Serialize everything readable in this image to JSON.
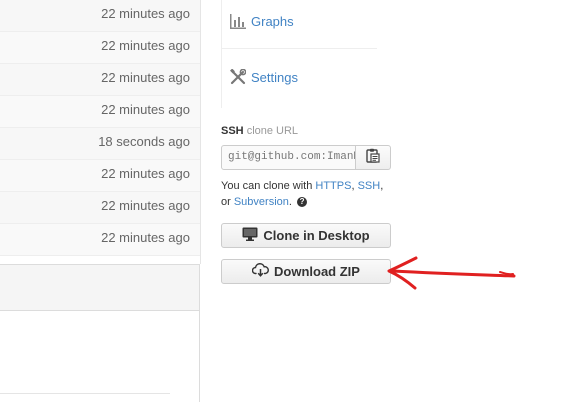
{
  "file_list": {
    "rows": [
      {
        "age": "22 minutes ago"
      },
      {
        "age": "22 minutes ago"
      },
      {
        "age": "22 minutes ago"
      },
      {
        "age": "22 minutes ago"
      },
      {
        "age": "18 seconds ago"
      },
      {
        "age": "22 minutes ago"
      },
      {
        "age": "22 minutes ago"
      },
      {
        "age": "22 minutes ago"
      }
    ]
  },
  "nav": {
    "graphs_label": "Graphs",
    "graphs_icon": "graph-icon",
    "settings_label": "Settings",
    "settings_icon": "tools-icon"
  },
  "clone": {
    "protocol": "SSH",
    "title_suffix": "clone URL",
    "url_value": "git@github.com:ImanM",
    "copy_icon": "clipboard-icon",
    "help_prefix": "You can clone with",
    "link_https": "HTTPS",
    "sep1": ",",
    "link_ssh": "SSH",
    "sep2": ",",
    "help_or": "or",
    "link_subversion": "Subversion",
    "help_period": ".",
    "help_icon": "question-icon"
  },
  "actions": {
    "clone_desktop_label": "Clone in Desktop",
    "clone_desktop_icon": "desktop-icon",
    "download_zip_label": "Download ZIP",
    "download_zip_icon": "cloud-download-icon"
  },
  "colors": {
    "link": "#4183c4",
    "annotation_arrow": "#e02020"
  }
}
